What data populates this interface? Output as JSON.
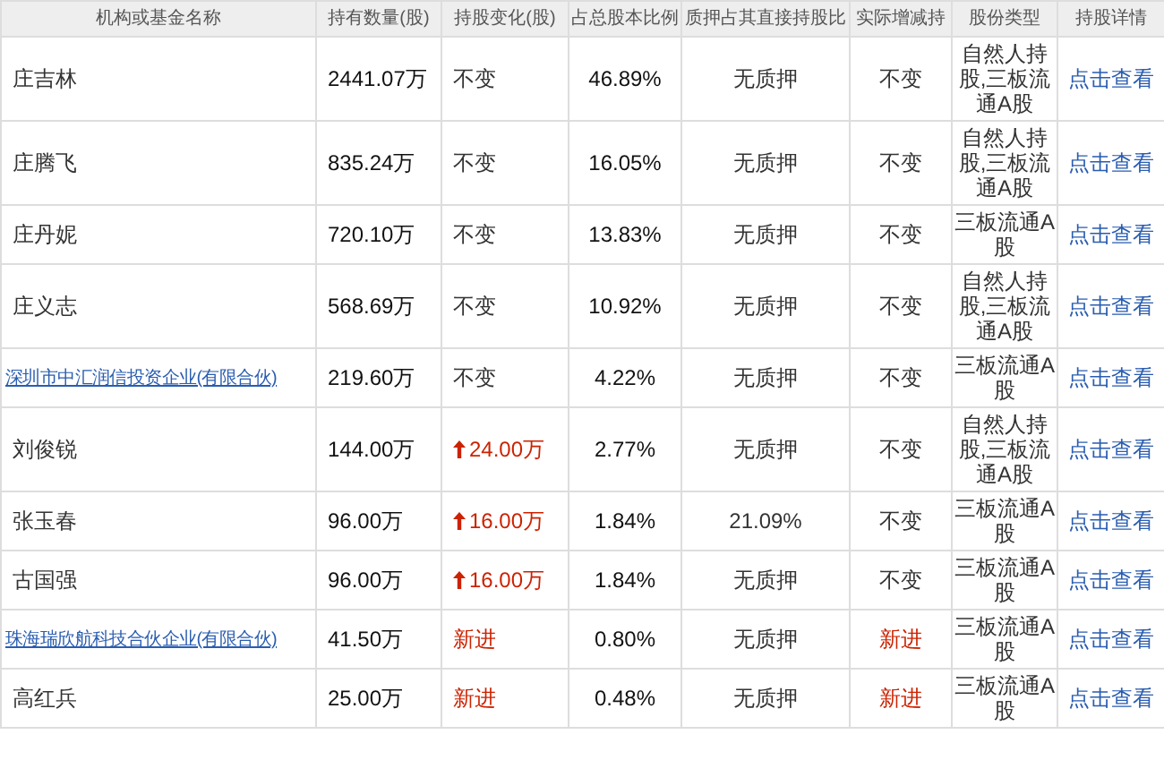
{
  "table": {
    "columns": [
      "机构或基金名称",
      "持有数量(股)",
      "持股变化(股)",
      "占总股本比例",
      "质押占其直接持股比",
      "实际增减持",
      "股份类型",
      "持股详情"
    ],
    "rows": [
      {
        "name": "庄吉林",
        "link": false,
        "shares": "2441.07万",
        "change": {
          "kind": "same",
          "text": "不变"
        },
        "ratio": "46.89%",
        "pledge": "无质押",
        "actual": {
          "kind": "same",
          "text": "不变"
        },
        "type_lines": [
          "自然人持",
          "股,三板流",
          "通A股"
        ],
        "detail": "点击查看"
      },
      {
        "name": "庄腾飞",
        "link": false,
        "shares": "835.24万",
        "change": {
          "kind": "same",
          "text": "不变"
        },
        "ratio": "16.05%",
        "pledge": "无质押",
        "actual": {
          "kind": "same",
          "text": "不变"
        },
        "type_lines": [
          "自然人持",
          "股,三板流",
          "通A股"
        ],
        "detail": "点击查看"
      },
      {
        "name": "庄丹妮",
        "link": false,
        "shares": "720.10万",
        "change": {
          "kind": "same",
          "text": "不变"
        },
        "ratio": "13.83%",
        "pledge": "无质押",
        "actual": {
          "kind": "same",
          "text": "不变"
        },
        "type_lines": [
          "三板流通A",
          "股"
        ],
        "detail": "点击查看"
      },
      {
        "name": "庄义志",
        "link": false,
        "shares": "568.69万",
        "change": {
          "kind": "same",
          "text": "不变"
        },
        "ratio": "10.92%",
        "pledge": "无质押",
        "actual": {
          "kind": "same",
          "text": "不变"
        },
        "type_lines": [
          "自然人持",
          "股,三板流",
          "通A股"
        ],
        "detail": "点击查看"
      },
      {
        "name": "深圳市中汇润信投资企业(有限合伙)",
        "link": true,
        "shares": "219.60万",
        "change": {
          "kind": "same",
          "text": "不变"
        },
        "ratio": "4.22%",
        "pledge": "无质押",
        "actual": {
          "kind": "same",
          "text": "不变"
        },
        "type_lines": [
          "三板流通A",
          "股"
        ],
        "detail": "点击查看"
      },
      {
        "name": "刘俊锐",
        "link": false,
        "shares": "144.00万",
        "change": {
          "kind": "up",
          "text": "24.00万"
        },
        "ratio": "2.77%",
        "pledge": "无质押",
        "actual": {
          "kind": "same",
          "text": "不变"
        },
        "type_lines": [
          "自然人持",
          "股,三板流",
          "通A股"
        ],
        "detail": "点击查看"
      },
      {
        "name": "张玉春",
        "link": false,
        "shares": "96.00万",
        "change": {
          "kind": "up",
          "text": "16.00万"
        },
        "ratio": "1.84%",
        "pledge": "21.09%",
        "actual": {
          "kind": "same",
          "text": "不变"
        },
        "type_lines": [
          "三板流通A",
          "股"
        ],
        "detail": "点击查看"
      },
      {
        "name": "古国强",
        "link": false,
        "shares": "96.00万",
        "change": {
          "kind": "up",
          "text": "16.00万"
        },
        "ratio": "1.84%",
        "pledge": "无质押",
        "actual": {
          "kind": "same",
          "text": "不变"
        },
        "type_lines": [
          "三板流通A",
          "股"
        ],
        "detail": "点击查看"
      },
      {
        "name": "珠海瑞欣航科技合伙企业(有限合伙)",
        "link": true,
        "shares": "41.50万",
        "change": {
          "kind": "new",
          "text": "新进"
        },
        "ratio": "0.80%",
        "pledge": "无质押",
        "actual": {
          "kind": "new",
          "text": "新进"
        },
        "type_lines": [
          "三板流通A",
          "股"
        ],
        "detail": "点击查看"
      },
      {
        "name": "高红兵",
        "link": false,
        "shares": "25.00万",
        "change": {
          "kind": "new",
          "text": "新进"
        },
        "ratio": "0.48%",
        "pledge": "无质押",
        "actual": {
          "kind": "new",
          "text": "新进"
        },
        "type_lines": [
          "三板流通A",
          "股"
        ],
        "detail": "点击查看"
      }
    ]
  }
}
